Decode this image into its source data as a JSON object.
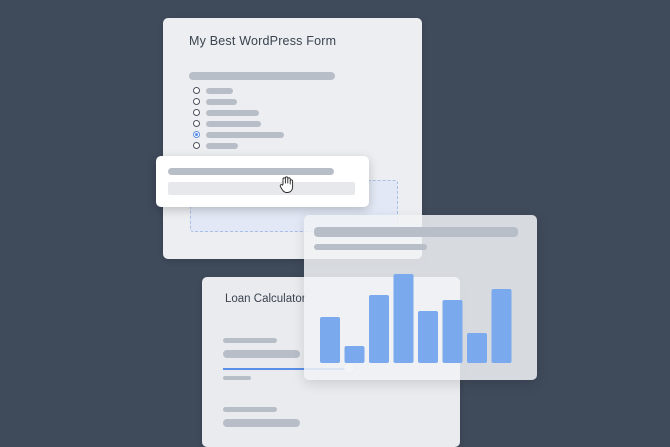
{
  "form_card": {
    "title": "My Best WordPress Form",
    "radio_options": [
      {
        "checked": false
      },
      {
        "checked": false
      },
      {
        "checked": false
      },
      {
        "checked": false
      },
      {
        "checked": true
      },
      {
        "checked": false
      }
    ]
  },
  "loan_card": {
    "title": "Loan Calculator",
    "slider_fraction": 0.9
  },
  "chart_data": {
    "type": "bar",
    "values": [
      46,
      17,
      68,
      89,
      52,
      63,
      30,
      74
    ],
    "colors": {
      "bar": "#7aa9ee"
    }
  }
}
